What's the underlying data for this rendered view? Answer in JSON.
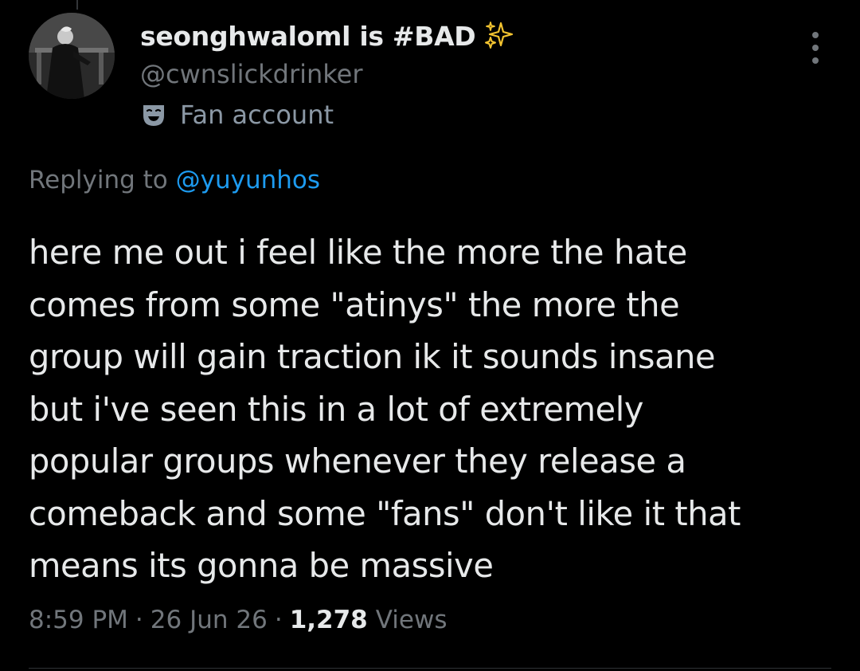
{
  "author": {
    "display_name": "seonghwaloml is #BAD",
    "handle": "@cwnslickdrinker",
    "account_label": "Fan account",
    "emoji_icon": "sparkles-icon",
    "label_icon": "theater-mask-icon"
  },
  "reply": {
    "prefix": "Replying to ",
    "mention": "@yuyunhos"
  },
  "tweet": {
    "lines": [
      "here me out i feel like the more the hate",
      "comes from some \"atinys\" the more the",
      "group will gain traction ik it sounds insane",
      "but i've seen this in a lot of extremely",
      "popular groups whenever they release a",
      "comeback and some \"fans\" don't like it that",
      "means its gonna be massive"
    ]
  },
  "meta": {
    "time": "8:59 PM",
    "separator": "·",
    "date": "26 Jun 26",
    "views_count": "1,278",
    "views_label": "Views"
  },
  "colors": {
    "background": "#000000",
    "text_primary": "#e7e9ea",
    "text_secondary": "#71767b",
    "link": "#1d9bf0",
    "sparkle": "#f4c430"
  }
}
